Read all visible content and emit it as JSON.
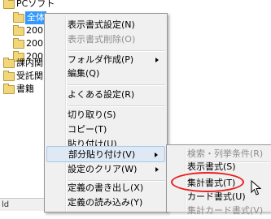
{
  "tree": {
    "items": [
      {
        "label": "PCソフト"
      },
      {
        "label": "全体"
      },
      {
        "label": "200"
      },
      {
        "label": "200"
      },
      {
        "label": "200"
      },
      {
        "label": "課内関"
      },
      {
        "label": "受託関"
      },
      {
        "label": "書籍"
      }
    ],
    "status_text": "ld"
  },
  "context_menu": {
    "items": [
      {
        "label": "表示書式設定(N)"
      },
      {
        "label": "表示書式削除(O)"
      },
      {
        "label": "フォルダ作成(P)"
      },
      {
        "label": "編集(Q)"
      },
      {
        "label": "よくある設定(R)"
      },
      {
        "label": "切り取り(S)"
      },
      {
        "label": "コピー(T)"
      },
      {
        "label": "貼り付け(U)"
      },
      {
        "label": "部分貼り付け(V)"
      },
      {
        "label": "設定のクリア(W)"
      },
      {
        "label": "定義の書き出し(X)"
      },
      {
        "label": "定義の読み込み(Y)"
      }
    ]
  },
  "submenu": {
    "items": [
      {
        "label": "検索・列挙条件(R)"
      },
      {
        "label": "表示書式(S)"
      },
      {
        "label": "集計書式(T)"
      },
      {
        "label": "カード書式(U)"
      },
      {
        "label": "集計カード書式(V)"
      }
    ]
  },
  "annotation_color": "#e81f1f",
  "highlight_color": "#dfe9f5"
}
